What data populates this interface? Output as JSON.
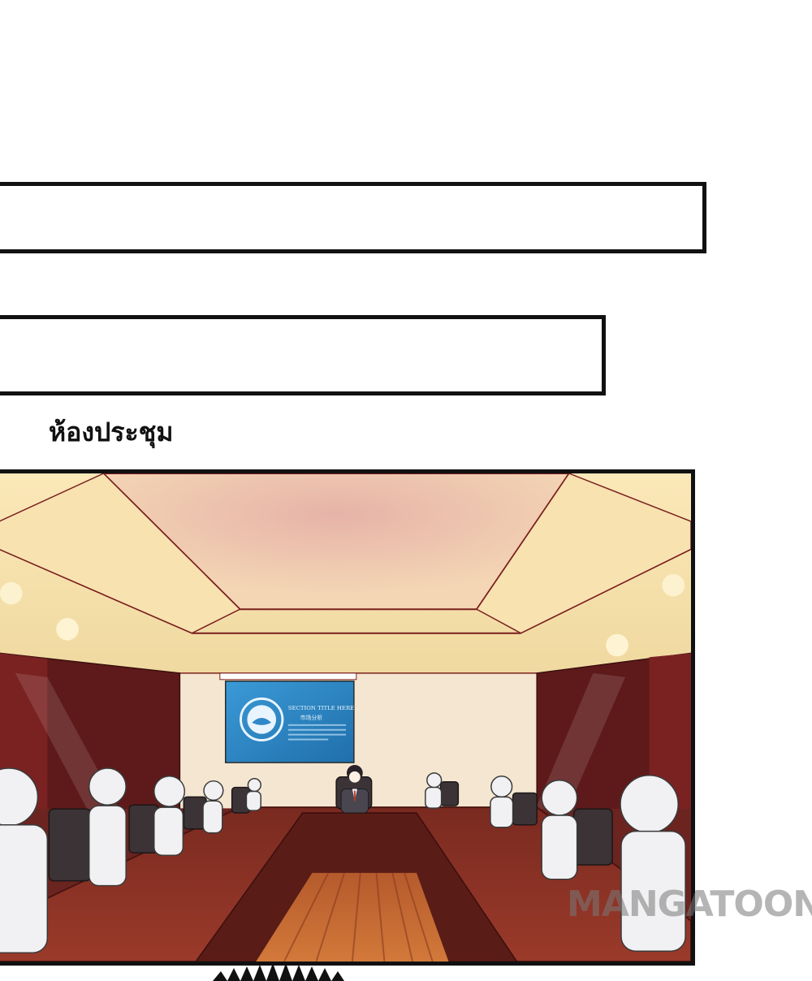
{
  "bubbles": [
    {
      "text": ""
    },
    {
      "text": ""
    }
  ],
  "caption": {
    "text": "ห้องประชุม"
  },
  "screen": {
    "title": "SECTION TITLE HERE",
    "subtitle": "市场分析"
  },
  "watermark": {
    "text": "MANGATOON"
  },
  "colors": {
    "ceiling": "#f6dca0",
    "ceiling_center": "#e9b7a8",
    "wall_panel": "#6a1d1d",
    "table": "#8a2e22",
    "screen": "#2f88c9",
    "figure": "#efeff2"
  },
  "icons": [
    "water-hand-logo-icon"
  ]
}
